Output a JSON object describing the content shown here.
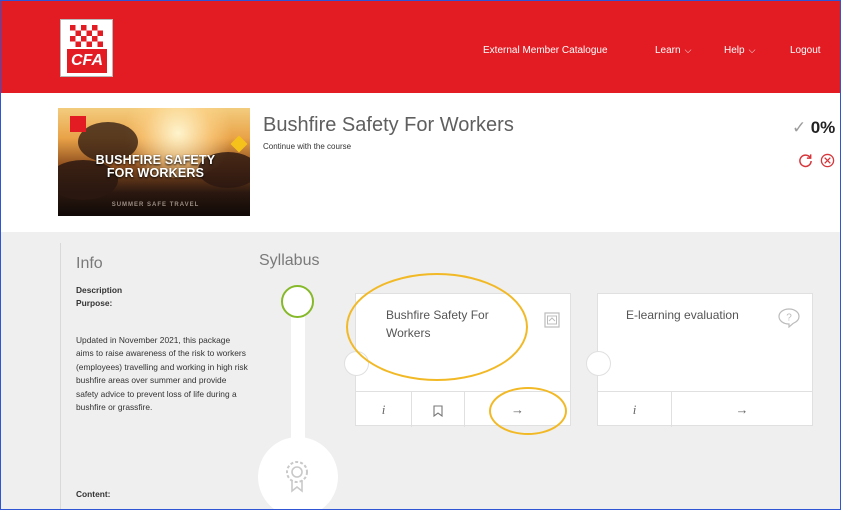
{
  "brand": {
    "logo_text": "CFA"
  },
  "nav": {
    "external_catalogue": "External Member Catalogue",
    "learn": "Learn",
    "help": "Help",
    "logout": "Logout",
    "chevron": "⌵"
  },
  "course": {
    "title": "Bushfire Safety For Workers",
    "subtitle": "Continue with the course",
    "hero_line1": "BUSHFIRE SAFETY",
    "hero_line2": "FOR WORKERS",
    "hero_tag": "SUMMER SAFE TRAVEL",
    "progress_icon": "✓",
    "progress": "0%",
    "restart_icon": "restart-icon",
    "cancel_icon": "cancel-icon"
  },
  "info": {
    "title": "Info",
    "description_label": "Description",
    "purpose_label": "Purpose:",
    "purpose_text": "Updated in November 2021, this package aims to raise awareness of the risk to workers (employees) travelling and working in high risk bushfire areas over summer and provide safety advice to prevent loss of life during a bushfire or grassfire.",
    "content_label": "Content:"
  },
  "syllabus": {
    "title": "Syllabus",
    "cards": [
      {
        "name": "Bushfire Safety For Workers",
        "info": "i",
        "bookmark": "⊓",
        "go": "→"
      },
      {
        "name": "E-learning evaluation",
        "info": "i",
        "go": "→"
      }
    ]
  },
  "colors": {
    "brand_red": "#e31b23",
    "highlight": "#f2b926",
    "complete_green": "#86b929"
  }
}
